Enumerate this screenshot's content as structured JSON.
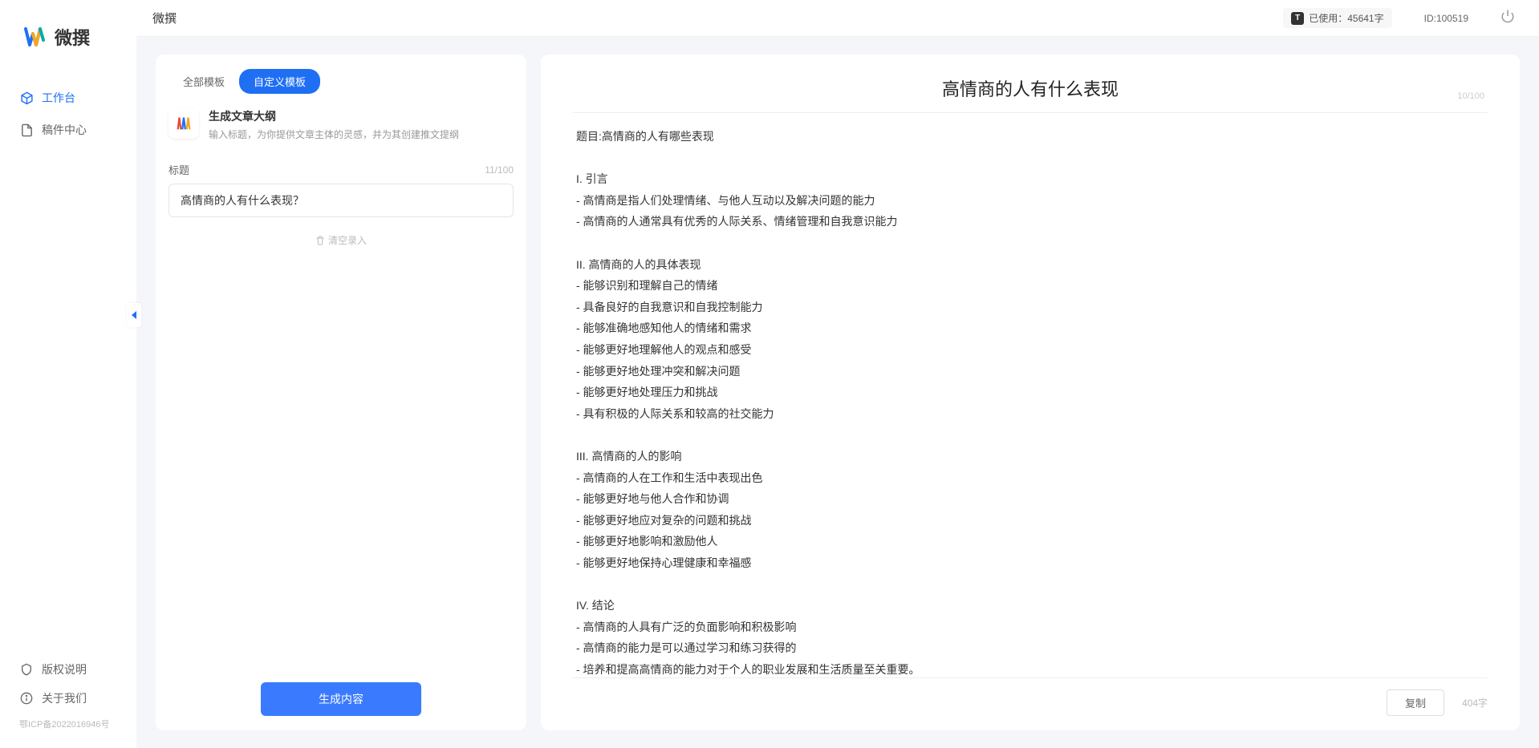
{
  "app_name_top": "微撰",
  "logo": {
    "text": "微撰"
  },
  "header": {
    "usage_label": "已使用：",
    "usage_value": "45641字",
    "user_id_label": "ID:",
    "user_id_value": "100519"
  },
  "sidebar": {
    "nav": [
      {
        "label": "工作台",
        "active": true
      },
      {
        "label": "稿件中心",
        "active": false
      }
    ],
    "bottom": [
      {
        "label": "版权说明"
      },
      {
        "label": "关于我们"
      }
    ],
    "icp": "鄂ICP备2022016946号"
  },
  "left_panel": {
    "tabs": [
      {
        "label": "全部模板",
        "active": false
      },
      {
        "label": "自定义模板",
        "active": true
      }
    ],
    "template": {
      "title": "生成文章大纲",
      "description": "输入标题，为你提供文章主体的灵感，并为其创建推文提纲"
    },
    "title_field": {
      "label": "标题",
      "value": "高情商的人有什么表现？",
      "count": "11/100"
    },
    "clear_label": "清空录入",
    "generate_btn": "生成内容"
  },
  "right_panel": {
    "title": "高情商的人有什么表现",
    "title_count": "10/100",
    "content": "题目:高情商的人有哪些表现\n\nI. 引言\n- 高情商是指人们处理情绪、与他人互动以及解决问题的能力\n- 高情商的人通常具有优秀的人际关系、情绪管理和自我意识能力\n\nII. 高情商的人的具体表现\n- 能够识别和理解自己的情绪\n- 具备良好的自我意识和自我控制能力\n- 能够准确地感知他人的情绪和需求\n- 能够更好地理解他人的观点和感受\n- 能够更好地处理冲突和解决问题\n- 能够更好地处理压力和挑战\n- 具有积极的人际关系和较高的社交能力\n\nIII. 高情商的人的影响\n- 高情商的人在工作和生活中表现出色\n- 能够更好地与他人合作和协调\n- 能够更好地应对复杂的问题和挑战\n- 能够更好地影响和激励他人\n- 能够更好地保持心理健康和幸福感\n\nIV. 结论\n- 高情商的人具有广泛的负面影响和积极影响\n- 高情商的能力是可以通过学习和练习获得的\n- 培养和提高高情商的能力对于个人的职业发展和生活质量至关重要。",
    "copy_btn": "复制",
    "word_count": "404字"
  }
}
